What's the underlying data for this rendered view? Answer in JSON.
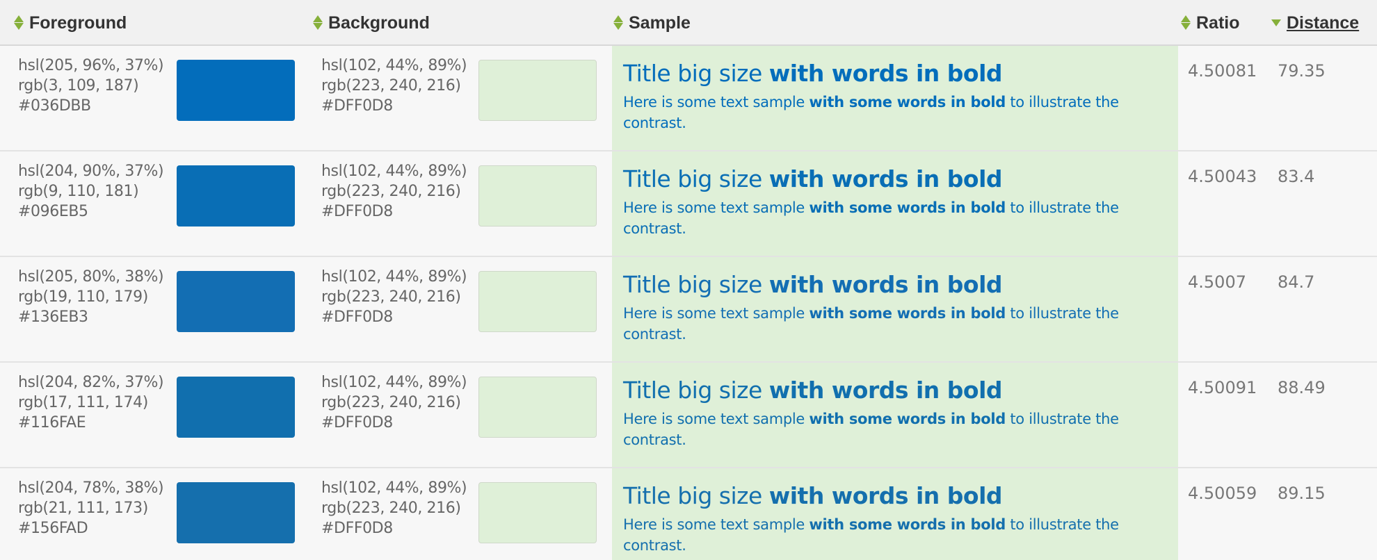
{
  "header": {
    "foreground": "Foreground",
    "background": "Background",
    "sample": "Sample",
    "ratio": "Ratio",
    "distance": "Distance"
  },
  "sample": {
    "title_plain": "Title big size ",
    "title_bold": "with words in bold",
    "body_plain": "Here is some text sample ",
    "body_bold": "with some words in bold",
    "body_tail": " to illustrate the contrast."
  },
  "rows": [
    {
      "fg": {
        "hsl": "hsl(205, 96%, 37%)",
        "rgb": "rgb(3, 109, 187)",
        "hex": "#036DBB"
      },
      "bg": {
        "hsl": "hsl(102, 44%, 89%)",
        "rgb": "rgb(223, 240, 216)",
        "hex": "#DFF0D8"
      },
      "ratio": "4.50081",
      "distance": "79.35"
    },
    {
      "fg": {
        "hsl": "hsl(204, 90%, 37%)",
        "rgb": "rgb(9, 110, 181)",
        "hex": "#096EB5"
      },
      "bg": {
        "hsl": "hsl(102, 44%, 89%)",
        "rgb": "rgb(223, 240, 216)",
        "hex": "#DFF0D8"
      },
      "ratio": "4.50043",
      "distance": "83.4"
    },
    {
      "fg": {
        "hsl": "hsl(205, 80%, 38%)",
        "rgb": "rgb(19, 110, 179)",
        "hex": "#136EB3"
      },
      "bg": {
        "hsl": "hsl(102, 44%, 89%)",
        "rgb": "rgb(223, 240, 216)",
        "hex": "#DFF0D8"
      },
      "ratio": "4.5007",
      "distance": "84.7"
    },
    {
      "fg": {
        "hsl": "hsl(204, 82%, 37%)",
        "rgb": "rgb(17, 111, 174)",
        "hex": "#116FAE"
      },
      "bg": {
        "hsl": "hsl(102, 44%, 89%)",
        "rgb": "rgb(223, 240, 216)",
        "hex": "#DFF0D8"
      },
      "ratio": "4.50091",
      "distance": "88.49"
    },
    {
      "fg": {
        "hsl": "hsl(204, 78%, 38%)",
        "rgb": "rgb(21, 111, 173)",
        "hex": "#156FAD"
      },
      "bg": {
        "hsl": "hsl(102, 44%, 89%)",
        "rgb": "rgb(223, 240, 216)",
        "hex": "#DFF0D8"
      },
      "ratio": "4.50059",
      "distance": "89.15"
    }
  ],
  "colors": {
    "sample_text": "#1b6bb9",
    "sample_bg": "#dfefd8",
    "sort_icon": "#86b03a"
  },
  "icons": [
    "sort-icon",
    "sort-desc-icon"
  ]
}
